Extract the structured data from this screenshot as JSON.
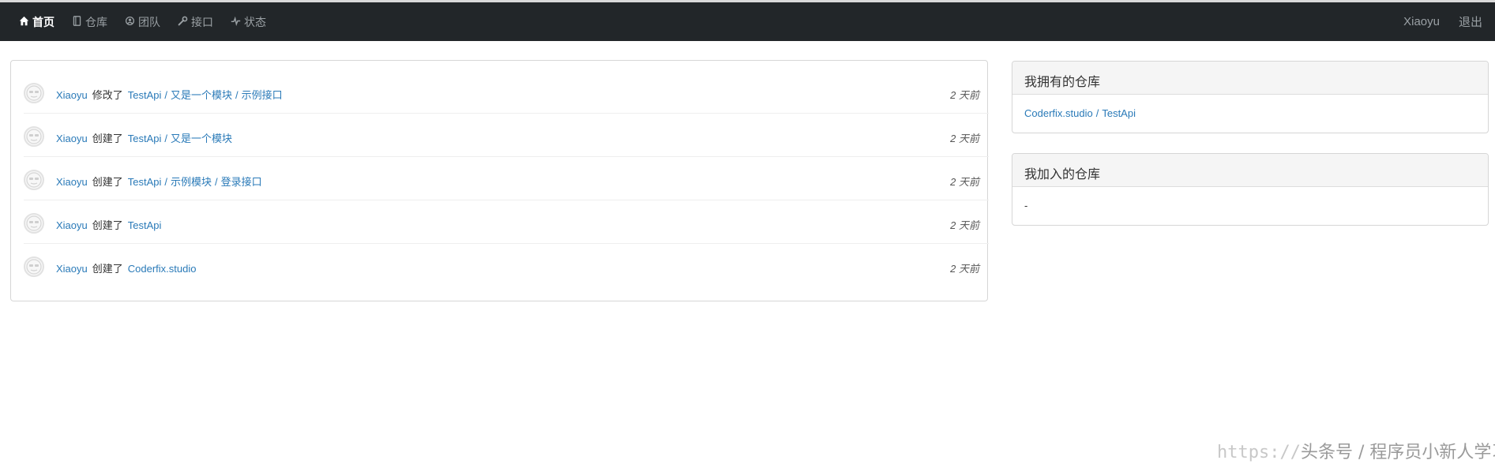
{
  "nav": {
    "items": [
      {
        "label": "首页",
        "icon": "home-icon",
        "active": true
      },
      {
        "label": "仓库",
        "icon": "repo-icon",
        "active": false
      },
      {
        "label": "团队",
        "icon": "team-icon",
        "active": false
      },
      {
        "label": "接口",
        "icon": "wrench-icon",
        "active": false
      },
      {
        "label": "状态",
        "icon": "pulse-icon",
        "active": false
      }
    ],
    "user": "Xiaoyu",
    "logout": "退出"
  },
  "feed": [
    {
      "user": "Xiaoyu",
      "verb": "修改了",
      "path": [
        "TestApi",
        "又是一个模块",
        "示例接口"
      ],
      "time": "2 天前"
    },
    {
      "user": "Xiaoyu",
      "verb": "创建了",
      "path": [
        "TestApi",
        "又是一个模块"
      ],
      "time": "2 天前"
    },
    {
      "user": "Xiaoyu",
      "verb": "创建了",
      "path": [
        "TestApi",
        "示例模块",
        "登录接口"
      ],
      "time": "2 天前"
    },
    {
      "user": "Xiaoyu",
      "verb": "创建了",
      "path": [
        "TestApi"
      ],
      "time": "2 天前"
    },
    {
      "user": "Xiaoyu",
      "verb": "创建了",
      "path": [
        "Coderfix.studio"
      ],
      "time": "2 天前"
    }
  ],
  "owned_repos": {
    "title": "我拥有的仓库",
    "org": "Coderfix.studio",
    "repo": "TestApi"
  },
  "joined_repos": {
    "title": "我加入的仓库",
    "empty": "-"
  },
  "watermark": {
    "url": "https://",
    "text": "头条号 / 程序员小新人学习"
  },
  "colors": {
    "navbar": "#222629",
    "link": "#2a7ab8",
    "panel_border": "#d6d6d6"
  }
}
